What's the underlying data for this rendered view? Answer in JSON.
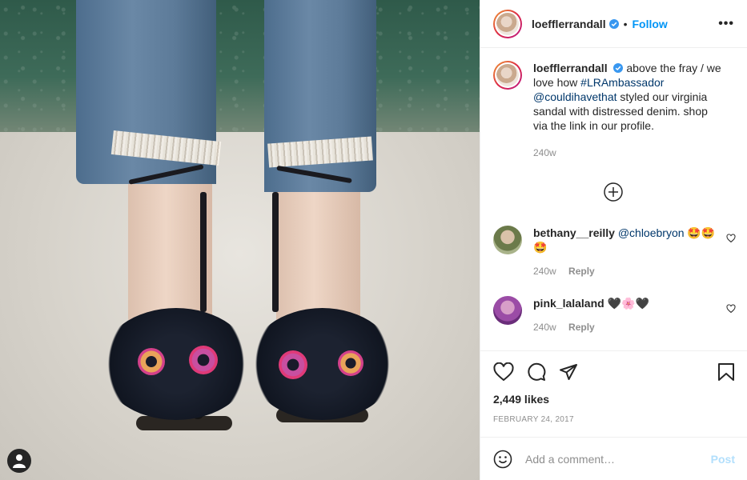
{
  "header": {
    "username": "loefflerrandall",
    "follow_label": "Follow",
    "more_label": "•••",
    "dot": "•"
  },
  "caption": {
    "username": "loefflerrandall",
    "text_before": "above the fray / we love how ",
    "hashtag": "#LRAmbassador",
    "mention": "@couldihavethat",
    "text_after": " styled our virginia sandal with distressed denim. shop via the link in our profile.",
    "time": "240w"
  },
  "comments": [
    {
      "username": "bethany__reilly",
      "mention": "@chloebryon",
      "emoji": "🤩🤩🤩",
      "time": "240w",
      "reply_label": "Reply"
    },
    {
      "username": "pink_lalaland",
      "emoji": "🖤🌸🖤",
      "time": "240w",
      "reply_label": "Reply"
    }
  ],
  "stats": {
    "likes": "2,449 likes",
    "date": "FEBRUARY 24, 2017"
  },
  "add_comment": {
    "placeholder": "Add a comment…",
    "post_label": "Post"
  },
  "icons": {
    "verified": "verified-badge-icon",
    "like": "heart-icon",
    "comment": "comment-icon",
    "share": "paper-plane-icon",
    "save": "bookmark-icon",
    "load_more": "plus-circle-icon",
    "emoji": "smiley-icon",
    "tagged_user": "user-icon"
  },
  "colors": {
    "accent": "#0095f6",
    "verified": "#3897f0",
    "post_disabled": "#b2dffc",
    "tag": "#00376b"
  }
}
